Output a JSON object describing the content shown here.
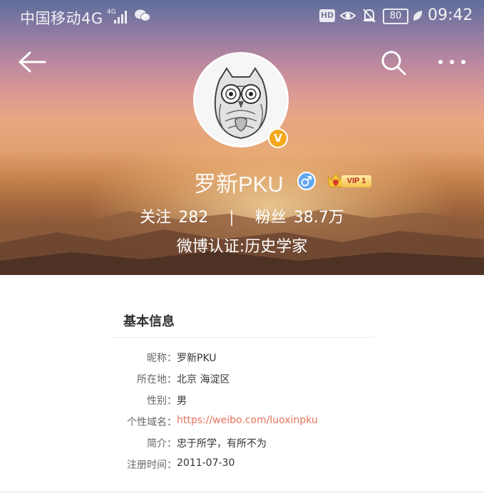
{
  "status_bar": {
    "carrier": "中国移动4G",
    "network_small": "4G",
    "hd": "HD",
    "battery": "80",
    "time": "09:42"
  },
  "profile": {
    "nickname": "罗新PKU",
    "verified_mark": "V",
    "vip_label": "VIP 1",
    "following_label": "关注",
    "following_count": "282",
    "stats_divider": "|",
    "followers_label": "粉丝",
    "followers_count": "38.7万",
    "verification": "微博认证:历史学家"
  },
  "basic_info": {
    "title": "基本信息",
    "rows": [
      {
        "label": "昵称：",
        "value": "罗新PKU"
      },
      {
        "label": "所在地：",
        "value": "北京 海淀区"
      },
      {
        "label": "性别：",
        "value": "男"
      },
      {
        "label": "个性域名：",
        "value": "https://weibo.com/luoxinpku"
      },
      {
        "label": "简介：",
        "value": "忠于所学，有所不为"
      },
      {
        "label": "注册时间：",
        "value": "2011-07-30"
      }
    ]
  },
  "colors": {
    "link": "#e8725b",
    "verified_badge": "#f4a81c",
    "gender_male": "#62a8ee"
  },
  "icons": [
    "back-arrow-icon",
    "search-icon",
    "more-icon",
    "eye-icon",
    "bell-off-icon",
    "wechat-icon",
    "signal-icon",
    "leaf-icon"
  ]
}
